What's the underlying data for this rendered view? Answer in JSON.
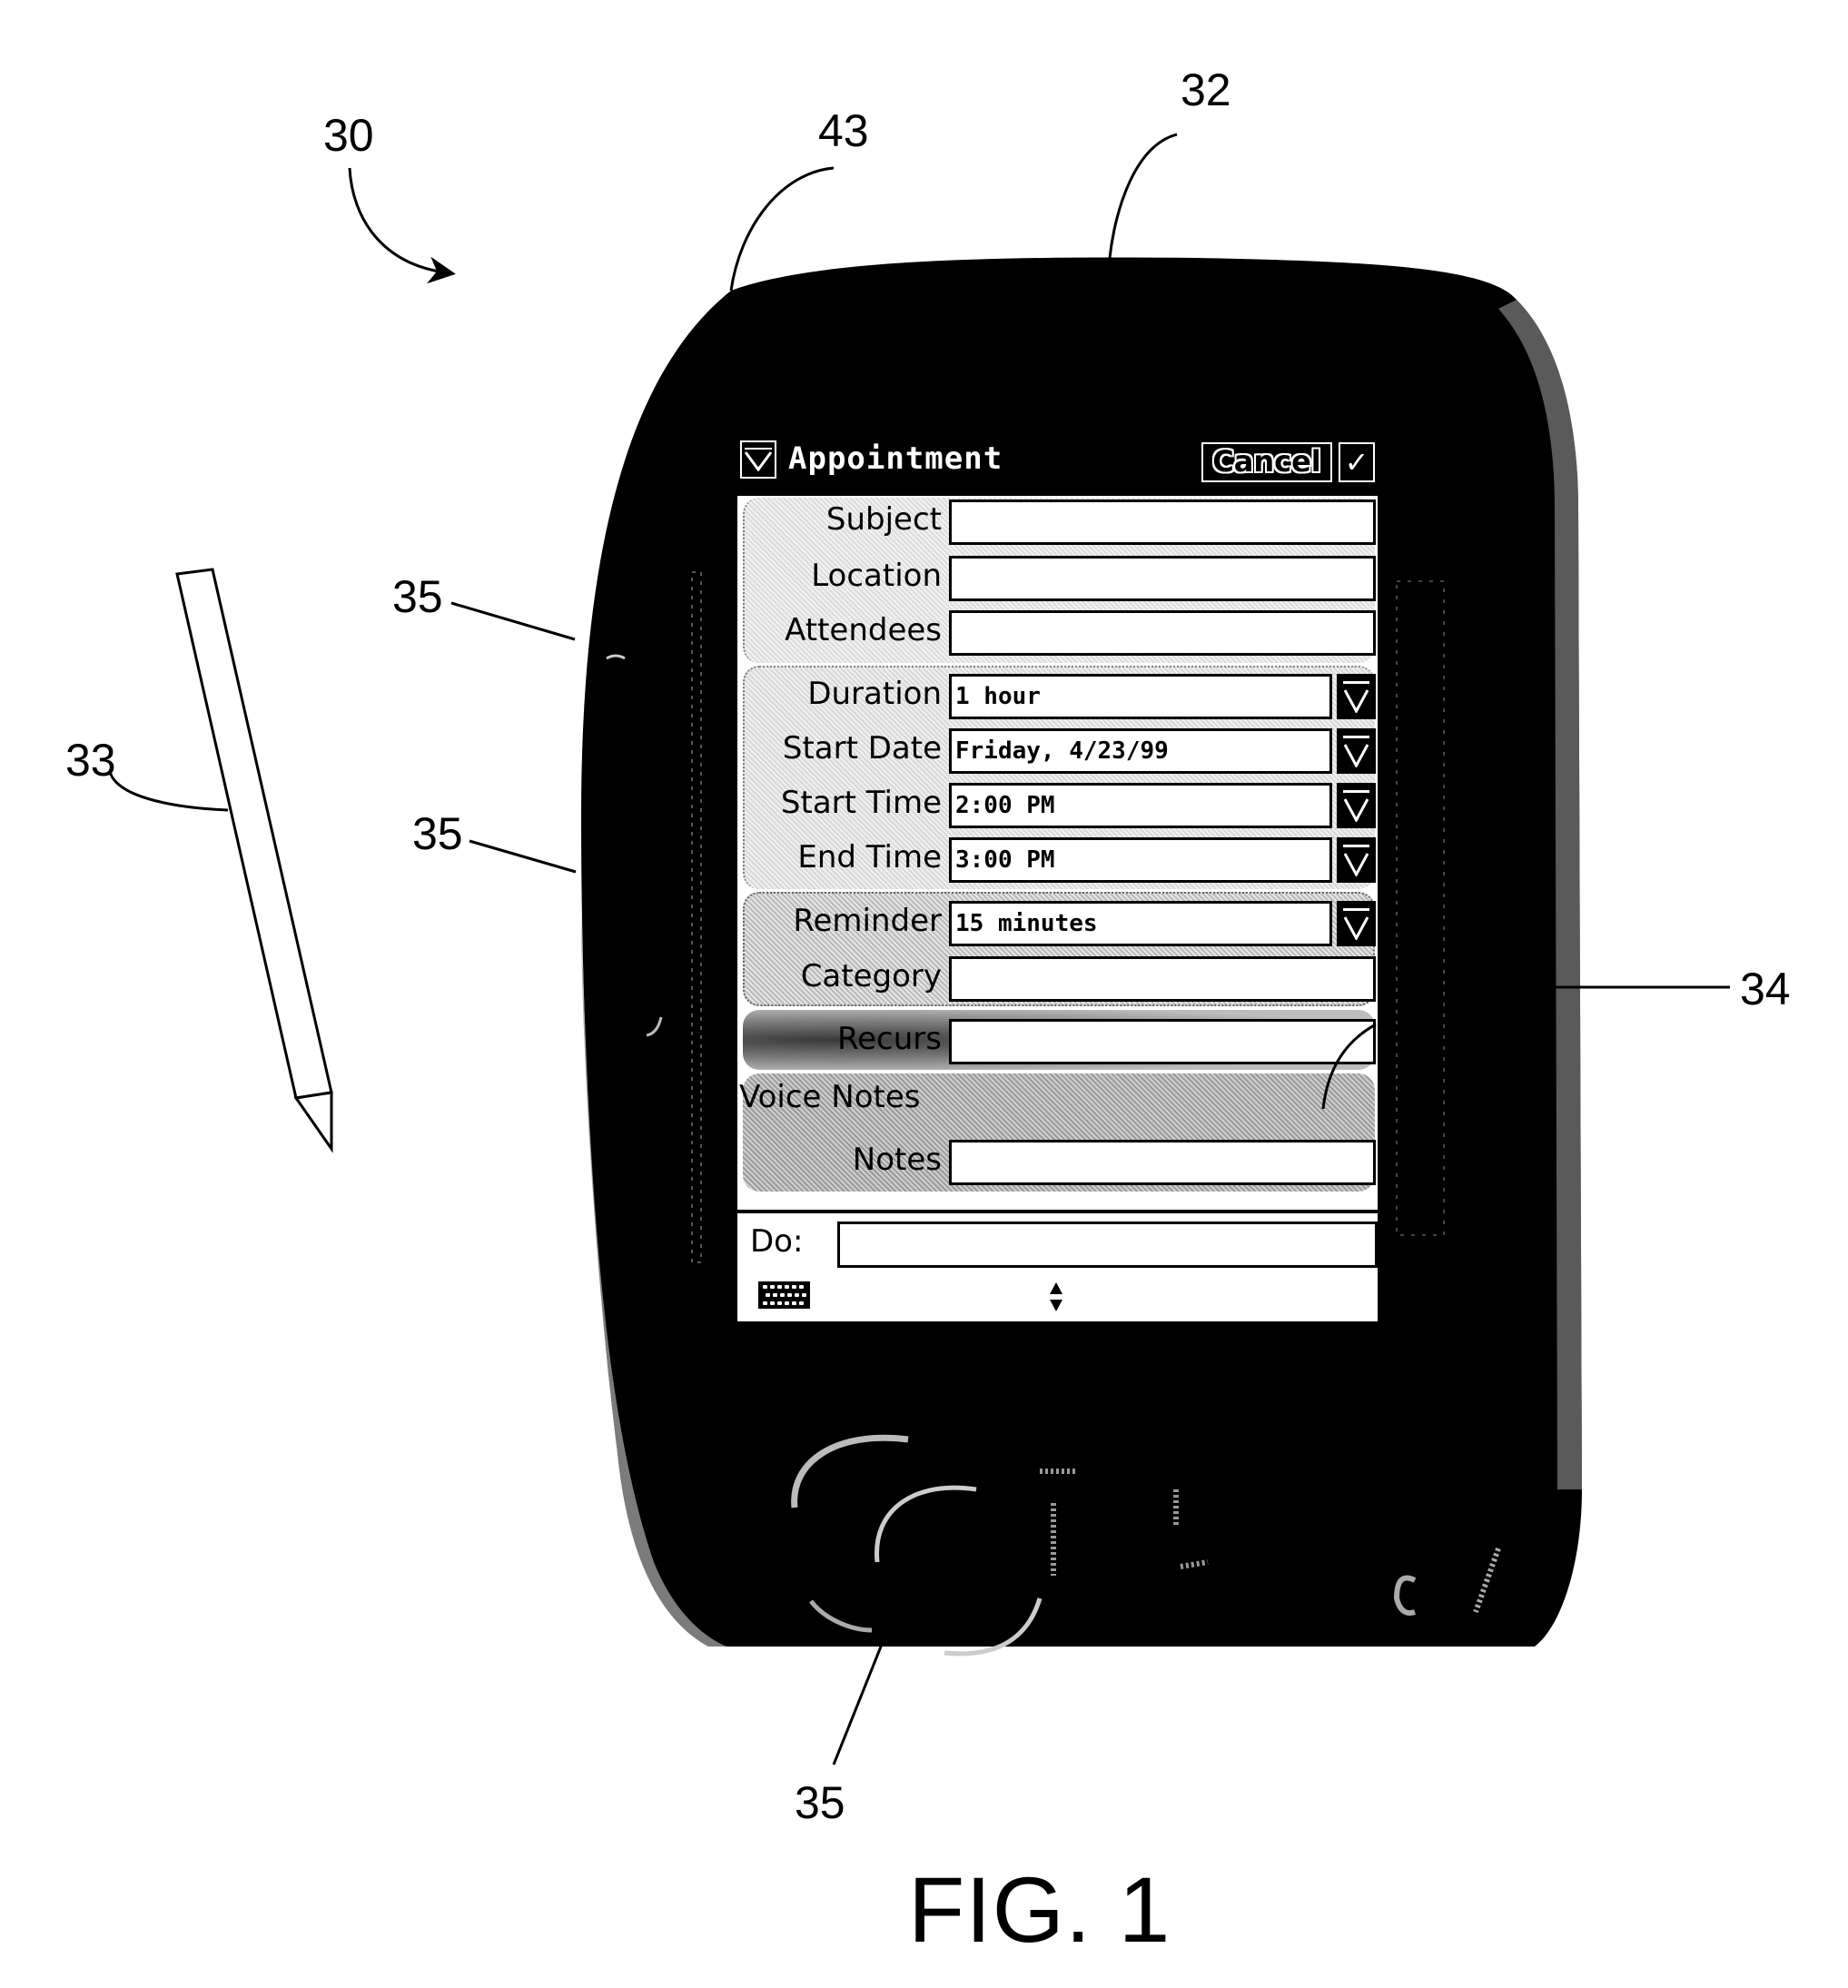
{
  "figure": {
    "caption": "FIG. 1",
    "reference_numerals": {
      "device": "30",
      "housing_top": "43",
      "housing": "32",
      "stylus": "33",
      "button_side_upper": "35",
      "button_side_lower": "35",
      "button_front": "35",
      "display": "34"
    }
  },
  "screen": {
    "title": "Appointment",
    "title_icon": "dropdown-menu-icon",
    "cancel_label": "Cancel",
    "ok_glyph": "✓",
    "fields": [
      {
        "label": "Subject",
        "value": "",
        "type": "text"
      },
      {
        "label": "Location",
        "value": "",
        "type": "text"
      },
      {
        "label": "Attendees",
        "value": "",
        "type": "text"
      },
      {
        "label": "Duration",
        "value": "1 hour",
        "type": "dropdown"
      },
      {
        "label": "Start Date",
        "value": "Friday, 4/23/99",
        "type": "dropdown"
      },
      {
        "label": "Start Time",
        "value": "2:00 PM",
        "type": "dropdown"
      },
      {
        "label": "End Time",
        "value": "3:00 PM",
        "type": "dropdown"
      },
      {
        "label": "Reminder",
        "value": "15 minutes",
        "type": "dropdown"
      },
      {
        "label": "Category",
        "value": "",
        "type": "text"
      },
      {
        "label": "Recurs",
        "value": "",
        "type": "text"
      },
      {
        "label": "Voice Notes",
        "value": "",
        "type": "none"
      },
      {
        "label": "Notes",
        "value": "",
        "type": "text"
      }
    ],
    "command_bar": {
      "do_label": "Do:",
      "do_value": "",
      "keyboard_icon": "keyboard-icon",
      "sip_icon": "up-down-arrows-icon"
    }
  }
}
